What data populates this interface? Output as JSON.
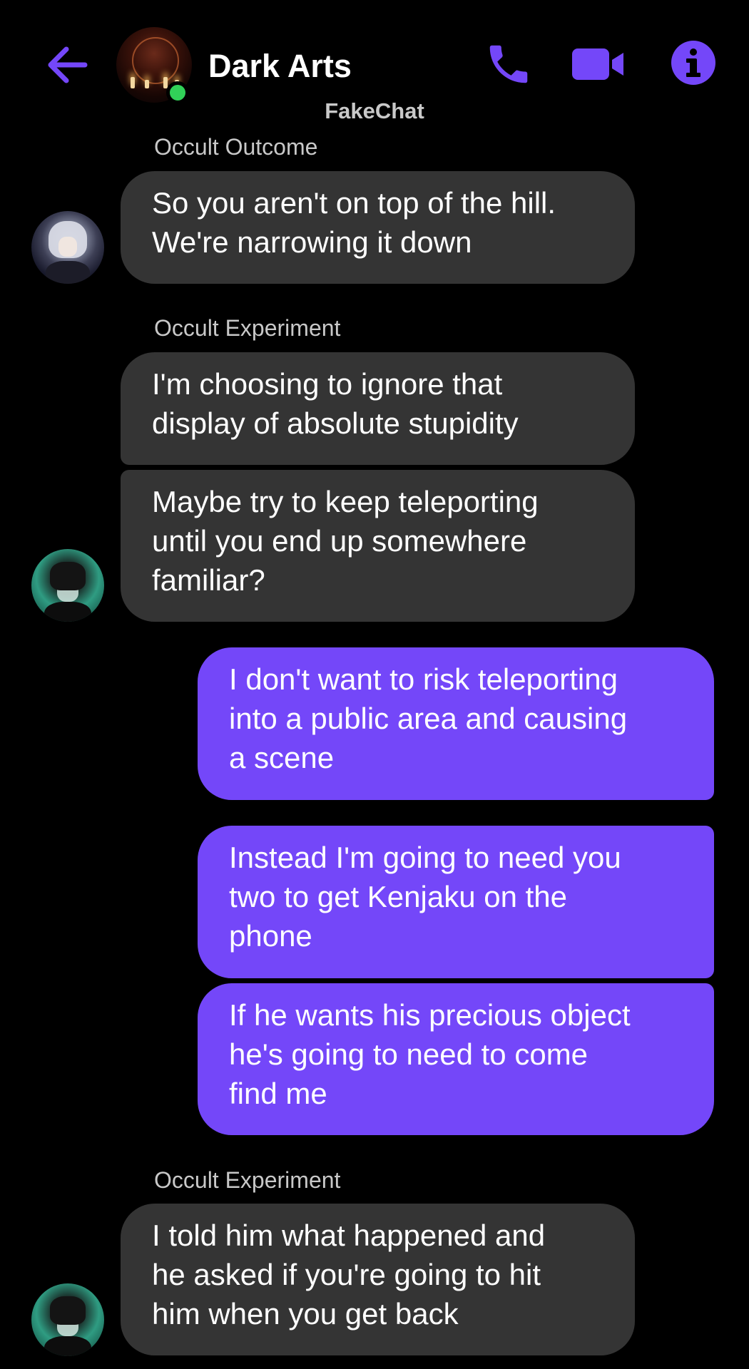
{
  "header": {
    "title": "Dark Arts",
    "watermark": "FakeChat",
    "icons": [
      "back-arrow-icon",
      "phone-icon",
      "video-camera-icon",
      "info-icon"
    ],
    "status": "online"
  },
  "colors": {
    "accent": "#7447f9",
    "incoming_bubble": "#343434",
    "background": "#000000",
    "online": "#31d158"
  },
  "messages": [
    {
      "sender": "Occult Outcome",
      "direction": "incoming",
      "texts": [
        "So you aren't on top of the hill.\nWe're narrowing it down"
      ]
    },
    {
      "sender": "Occult Experiment",
      "direction": "incoming",
      "texts": [
        "I'm choosing to ignore that\ndisplay of absolute stupidity",
        "Maybe try to keep teleporting\nuntil you end up somewhere\nfamiliar?"
      ]
    },
    {
      "direction": "outgoing",
      "texts": [
        "I don't want to risk teleporting\ninto a public area and causing\na scene",
        "Instead I'm going to need you\ntwo to get Kenjaku on the\nphone",
        "If he wants his precious object\nhe's going to need to come\nfind me"
      ]
    },
    {
      "sender": "Occult Experiment",
      "direction": "incoming",
      "texts": [
        "I told him what happened and\nhe asked if you're going to hit\nhim when you get back"
      ]
    }
  ]
}
